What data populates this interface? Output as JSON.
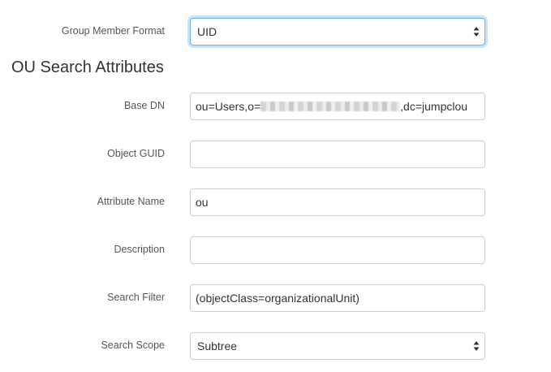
{
  "group_member_format": {
    "label": "Group Member Format",
    "value": "UID"
  },
  "ou_section": {
    "title": "OU Search Attributes",
    "fields": {
      "base_dn": {
        "label": "Base DN",
        "value_prefix": "ou=Users,o=",
        "value_suffix": ",dc=jumpclou"
      },
      "object_guid": {
        "label": "Object GUID",
        "value": ""
      },
      "attribute_name": {
        "label": "Attribute Name",
        "value": "ou"
      },
      "description": {
        "label": "Description",
        "value": ""
      },
      "search_filter": {
        "label": "Search Filter",
        "value": "(objectClass=organizationalUnit)"
      },
      "search_scope": {
        "label": "Search Scope",
        "value": "Subtree"
      }
    }
  }
}
